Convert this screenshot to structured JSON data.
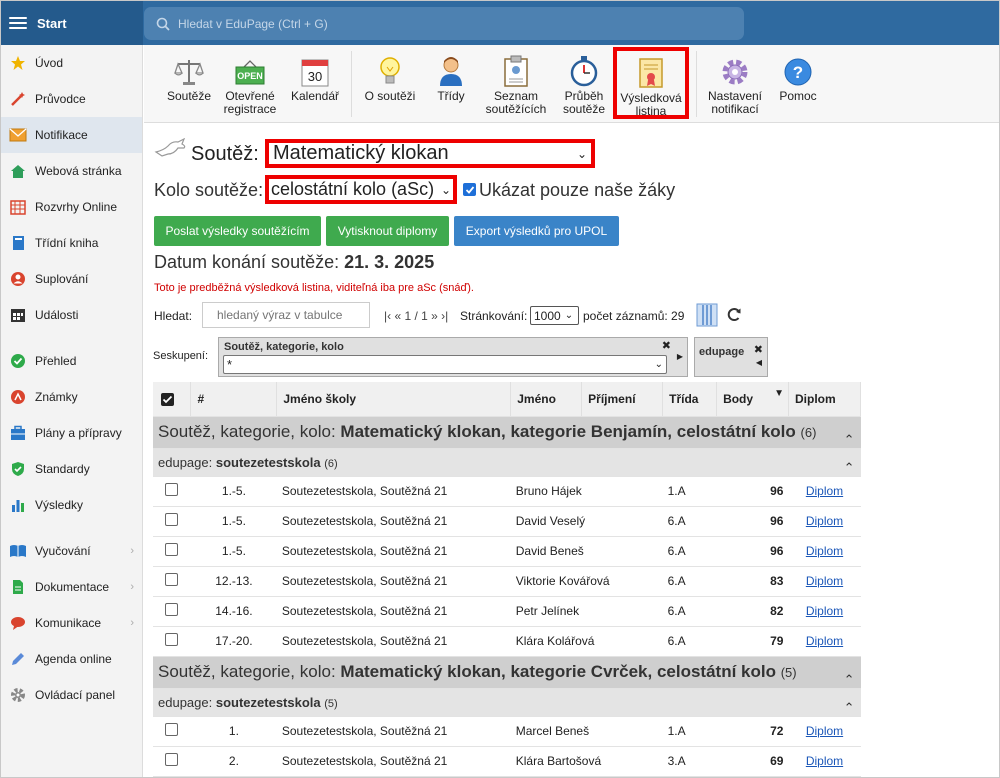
{
  "topbar": {
    "start_label": "Start",
    "search_placeholder": "Hledat v EduPage (Ctrl + G)"
  },
  "sidebar": {
    "items": [
      {
        "label": "Úvod",
        "icon": "star-icon",
        "color": "#f0b400"
      },
      {
        "label": "Průvodce",
        "icon": "magic-wand-icon",
        "color": "#d9442e"
      },
      {
        "label": "Notifikace",
        "icon": "envelope-icon",
        "color": "#f0a030"
      },
      {
        "label": "Webová stránka",
        "icon": "home-icon",
        "color": "#2e9e5a"
      },
      {
        "label": "Rozvrhy Online",
        "icon": "calendar-grid-icon",
        "color": "#d9442e"
      },
      {
        "label": "Třídní kniha",
        "icon": "book-icon",
        "color": "#2a78c8"
      },
      {
        "label": "Suplování",
        "icon": "person-icon",
        "color": "#d9442e"
      },
      {
        "label": "Události",
        "icon": "calendar-icon",
        "color": "#333"
      },
      {
        "label": "Přehled",
        "icon": "check-circle-icon",
        "color": "#2eaa4a"
      },
      {
        "label": "Známky",
        "icon": "grade-icon",
        "color": "#d9442e"
      },
      {
        "label": "Plány a přípravy",
        "icon": "briefcase-icon",
        "color": "#2a78c8"
      },
      {
        "label": "Standardy",
        "icon": "shield-icon",
        "color": "#2eaa4a"
      },
      {
        "label": "Výsledky",
        "icon": "bar-chart-icon",
        "color": "#2a78c8"
      },
      {
        "label": "Vyučování",
        "icon": "open-book-icon",
        "color": "#2a78c8"
      },
      {
        "label": "Dokumentace",
        "icon": "document-icon",
        "color": "#2eaa4a"
      },
      {
        "label": "Komunikace",
        "icon": "chat-icon",
        "color": "#d9442e"
      },
      {
        "label": "Agenda online",
        "icon": "pen-icon",
        "color": "#5a8ad8"
      },
      {
        "label": "Ovládací panel",
        "icon": "gear-icon",
        "color": "#888"
      }
    ]
  },
  "toolbar": {
    "items": [
      {
        "label": "Soutěže",
        "icon": "scales-icon"
      },
      {
        "label": "Otevřené registrace",
        "line1": "Otevřené",
        "line2": "registrace",
        "icon": "open-sign-icon",
        "badge": "OPEN"
      },
      {
        "label": "Kalendář",
        "icon": "calendar-icon",
        "badge": "30"
      },
      {
        "label": "O soutěži",
        "icon": "lightbulb-icon"
      },
      {
        "label": "Třídy",
        "icon": "person-icon"
      },
      {
        "label": "Seznam soutěžících",
        "line1": "Seznam",
        "line2": "soutěžících",
        "icon": "clipboard-icon"
      },
      {
        "label": "Průběh soutěže",
        "line1": "Průběh",
        "line2": "soutěže",
        "icon": "stopwatch-icon"
      },
      {
        "label": "Výsledková listina",
        "line1": "Výsledková",
        "line2": "listina",
        "icon": "certificate-icon"
      },
      {
        "label": "Nastavení notifikací",
        "line1": "Nastavení",
        "line2": "notifikací",
        "icon": "gear-icon"
      },
      {
        "label": "Pomoc",
        "icon": "help-icon",
        "badge": "?"
      }
    ]
  },
  "competition": {
    "label": "Soutěž:",
    "value": "Matematický klokan"
  },
  "round": {
    "label": "Kolo soutěže:",
    "value": "celostátní kolo (aSc)",
    "only_ours_label": "Ukázat pouze naše žáky",
    "only_ours_checked": true
  },
  "buttons": {
    "send": "Poslat výsledky soutěžícím",
    "print": "Vytisknout diplomy",
    "export": "Export výsledků pro UPOL"
  },
  "date": {
    "label": "Datum konání soutěže:",
    "value": "21. 3. 2025"
  },
  "notice": "Toto je predběžná výsledková listina, viditeľná iba pre aSc (snáď).",
  "filter": {
    "label": "Hledat:",
    "placeholder": "hledaný výraz v tabulce",
    "pager": "|‹ « 1 / 1 » ›|",
    "paging_label": "Stránkování:",
    "paging_value": "1000",
    "count_label": "počet záznamů: 29"
  },
  "grouping": {
    "label": "Seskupení:",
    "field1_title": "Soutěž, kategorie, kolo",
    "field1_value": "*",
    "field2_title": "edupage"
  },
  "table": {
    "columns": [
      "#",
      "Jméno školy",
      "Jméno",
      "Příjmení",
      "Třída",
      "Body",
      "Diplom"
    ],
    "groups": [
      {
        "title_prefix": "Soutěž, kategorie, kolo:",
        "title": "Matematický klokan, kategorie Benjamín, celostátní kolo",
        "count": "(6)",
        "sub_prefix": "edupage:",
        "sub": "soutezetestskola",
        "sub_count": "(6)",
        "rows": [
          {
            "rank": "1.-5.",
            "school": "Soutezetestskola, Soutěžná 21",
            "name": "Bruno Hájek",
            "class": "1.A",
            "points": "96",
            "diploma": "Diplom"
          },
          {
            "rank": "1.-5.",
            "school": "Soutezetestskola, Soutěžná 21",
            "name": "David Veselý",
            "class": "6.A",
            "points": "96",
            "diploma": "Diplom"
          },
          {
            "rank": "1.-5.",
            "school": "Soutezetestskola, Soutěžná 21",
            "name": "David Beneš",
            "class": "6.A",
            "points": "96",
            "diploma": "Diplom"
          },
          {
            "rank": "12.-13.",
            "school": "Soutezetestskola, Soutěžná 21",
            "name": "Viktorie Kovářová",
            "class": "6.A",
            "points": "83",
            "diploma": "Diplom"
          },
          {
            "rank": "14.-16.",
            "school": "Soutezetestskola, Soutěžná 21",
            "name": "Petr Jelínek",
            "class": "6.A",
            "points": "82",
            "diploma": "Diplom"
          },
          {
            "rank": "17.-20.",
            "school": "Soutezetestskola, Soutěžná 21",
            "name": "Klára Kolářová",
            "class": "6.A",
            "points": "79",
            "diploma": "Diplom"
          }
        ]
      },
      {
        "title_prefix": "Soutěž, kategorie, kolo:",
        "title": "Matematický klokan, kategorie Cvrček, celostátní kolo",
        "count": "(5)",
        "sub_prefix": "edupage:",
        "sub": "soutezetestskola",
        "sub_count": "(5)",
        "rows": [
          {
            "rank": "1.",
            "school": "Soutezetestskola, Soutěžná 21",
            "name": "Marcel Beneš",
            "class": "1.A",
            "points": "72",
            "diploma": "Diplom"
          },
          {
            "rank": "2.",
            "school": "Soutezetestskola, Soutěžná 21",
            "name": "Klára Bartošová",
            "class": "3.A",
            "points": "69",
            "diploma": "Diplom"
          }
        ]
      }
    ]
  },
  "colors": {
    "topbar": "#2f6aa0",
    "start": "#245a8c",
    "btn_green": "#3faa4e",
    "btn_blue": "#3a84c8",
    "highlight_red": "#e00000",
    "notice_red": "#d00000",
    "link": "#1a56b8"
  }
}
